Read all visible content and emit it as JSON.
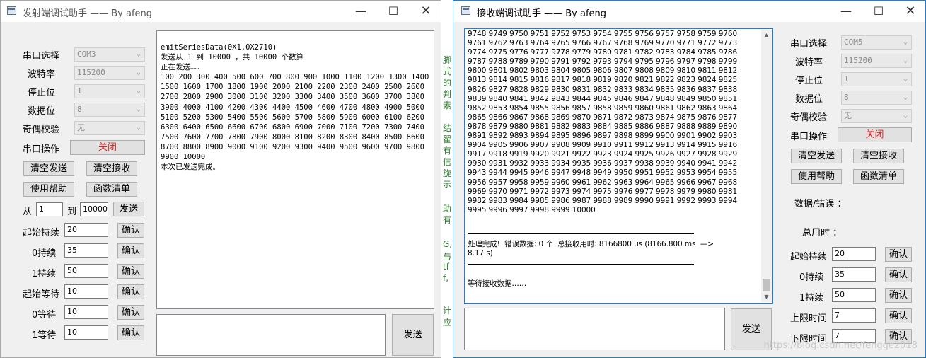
{
  "left": {
    "title": "发射端调试助手 —— By afeng",
    "labels": [
      "串口选择",
      "波特率",
      "停止位",
      "数据位",
      "奇偶校验",
      "串口操作"
    ],
    "combos": [
      "COM3",
      "115200",
      "1",
      "8",
      "无"
    ],
    "open_close": "关闭",
    "btn_clear_send": "清空发送",
    "btn_clear_recv": "清空接收",
    "btn_help": "使用帮助",
    "btn_funcs": "函数清单",
    "range": {
      "from_label": "从",
      "from": "1",
      "to_label": "到",
      "to": "10000",
      "send": "发送"
    },
    "params": [
      {
        "label": "起始持续",
        "value": "20",
        "btn": "确认"
      },
      {
        "label": "0持续",
        "value": "35",
        "btn": "确认"
      },
      {
        "label": "1持续",
        "value": "50",
        "btn": "确认"
      },
      {
        "label": "起始等待",
        "value": "10",
        "btn": "确认"
      },
      {
        "label": "0等待",
        "value": "10",
        "btn": "确认"
      },
      {
        "label": "1等待",
        "value": "10",
        "btn": "确认"
      }
    ],
    "log": "emitSeriesData(0X1,0X2710)\n发送从 1 到 10000 ，共 10000 个数算\n正在发送……\n100 200 300 400 500 600 700 800 900 1000 1100 1200 1300 1400\n1500 1600 1700 1800 1900 2000 2100 2200 2300 2400 2500 2600\n2700 2800 2900 3000 3100 3200 3300 3400 3500 3600 3700 3800\n3900 4000 4100 4200 4300 4400 4500 4600 4700 4800 4900 5000\n5100 5200 5300 5400 5500 5600 5700 5800 5900 6000 6100 6200\n6300 6400 6500 6600 6700 6800 6900 7000 7100 7200 7300 7400\n7500 7600 7700 7800 7900 8000 8100 8200 8300 8400 8500 8600\n8700 8800 8900 9000 9100 9200 9300 9400 9500 9600 9700 9800\n9900 10000\n本次已发送完成。",
    "send_btn": "发送"
  },
  "right": {
    "title": "接收端调试助手 —— By afeng",
    "labels": [
      "串口选择",
      "波特率",
      "停止位",
      "数据位",
      "奇偶校验",
      "串口操作"
    ],
    "combos": [
      "COM5",
      "115200",
      "1",
      "8",
      "无"
    ],
    "open_close": "关闭",
    "btn_clear_send": "清空发送",
    "btn_clear_recv": "清空接收",
    "btn_help": "使用帮助",
    "btn_funcs": "函数清单",
    "stat_data_err": "数据/错误 ：",
    "stat_total_time": "总用时 ：",
    "params": [
      {
        "label": "起始持续",
        "value": "20",
        "btn": "确认"
      },
      {
        "label": "0持续",
        "value": "35",
        "btn": "确认"
      },
      {
        "label": "1持续",
        "value": "50",
        "btn": "确认"
      },
      {
        "label": "上限时间",
        "value": "7",
        "btn": "确认"
      },
      {
        "label": "下限时间",
        "value": "7",
        "btn": "确认"
      }
    ],
    "numbers": "9748 9749 9750 9751 9752 9753 9754 9755 9756 9757 9758 9759 9760\n9761 9762 9763 9764 9765 9766 9767 9768 9769 9770 9771 9772 9773\n9774 9775 9776 9777 9778 9779 9780 9781 9782 9783 9784 9785 9786\n9787 9788 9789 9790 9791 9792 9793 9794 9795 9796 9797 9798 9799\n9800 9801 9802 9803 9804 9805 9806 9807 9808 9809 9810 9811 9812\n9813 9814 9815 9816 9817 9818 9819 9820 9821 9822 9823 9824 9825\n9826 9827 9828 9829 9830 9831 9832 9833 9834 9835 9836 9837 9838\n9839 9840 9841 9842 9843 9844 9845 9846 9847 9848 9849 9850 9851\n9852 9853 9854 9855 9856 9857 9858 9859 9860 9861 9862 9863 9864\n9865 9866 9867 9868 9869 9870 9871 9872 9873 9874 9875 9876 9877\n9878 9879 9880 9881 9882 9883 9884 9885 9886 9887 9888 9889 9890\n9891 9892 9893 9894 9895 9896 9897 9898 9899 9900 9901 9902 9903\n9904 9905 9906 9907 9908 9909 9910 9911 9912 9913 9914 9915 9916\n9917 9918 9919 9920 9921 9922 9923 9924 9925 9926 9927 9928 9929\n9930 9931 9932 9933 9934 9935 9936 9937 9938 9939 9940 9941 9942\n9943 9944 9945 9946 9947 9948 9949 9950 9951 9952 9953 9954 9955\n9956 9957 9958 9959 9960 9961 9962 9963 9964 9965 9966 9967 9968\n9969 9970 9971 9972 9973 9974 9975 9976 9977 9978 9979 9980 9981\n9982 9983 9984 9985 9986 9987 9988 9989 9990 9991 9992 9993 9994\n9995 9996 9997 9998 9999 10000",
    "done_line": "处理完成!  错误数据: 0 个  总接收用时: 8166800 us (8166.800 ms  —>\n8.17 s)",
    "waiting": "等待接收数据……",
    "send_btn": "发送"
  },
  "background_fragments": [
    "脚",
    "式",
    "的",
    "判",
    "素",
    "|",
    "结",
    "翟",
    "有",
    "信",
    "旋",
    "示",
    "",
    "",
    "助",
    "有",
    "",
    "G,",
    "与",
    "tf",
    "",
    "f,",
    "",
    "",
    "",
    "计应"
  ],
  "watermark": "https://blog.csdn.net/fengge2018"
}
